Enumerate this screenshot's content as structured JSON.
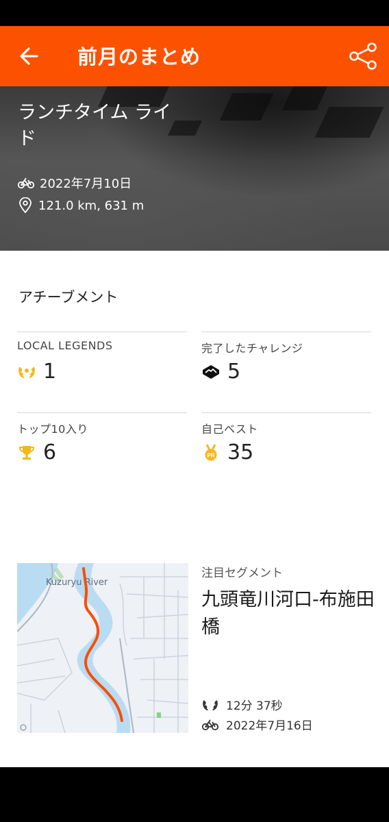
{
  "header": {
    "title": "前月のまとめ",
    "back_icon": "arrow-left-icon",
    "share_icon": "share-icon",
    "color": "#fc5200"
  },
  "featured_activity": {
    "title": "ランチタイム ライド",
    "date": "2022年7月10日",
    "stats": "121.0 km, 631 m"
  },
  "achievements": {
    "heading": "アチーブメント",
    "items": [
      {
        "label": "LOCAL LEGENDS",
        "value": "1",
        "icon": "laurel-icon"
      },
      {
        "label": "完了したチャレンジ",
        "value": "5",
        "icon": "challenge-icon"
      },
      {
        "label": "トップ10入り",
        "value": "6",
        "icon": "trophy-icon"
      },
      {
        "label": "自己ベスト",
        "value": "35",
        "icon": "pr-medal-icon"
      }
    ]
  },
  "segment": {
    "label": "注目セグメント",
    "name": "九頭竜川河口-布施田橋",
    "time": "12分 37秒",
    "date": "2022年7月16日",
    "map_label": "Kuzuryu River",
    "route_color": "#fc4c02"
  }
}
